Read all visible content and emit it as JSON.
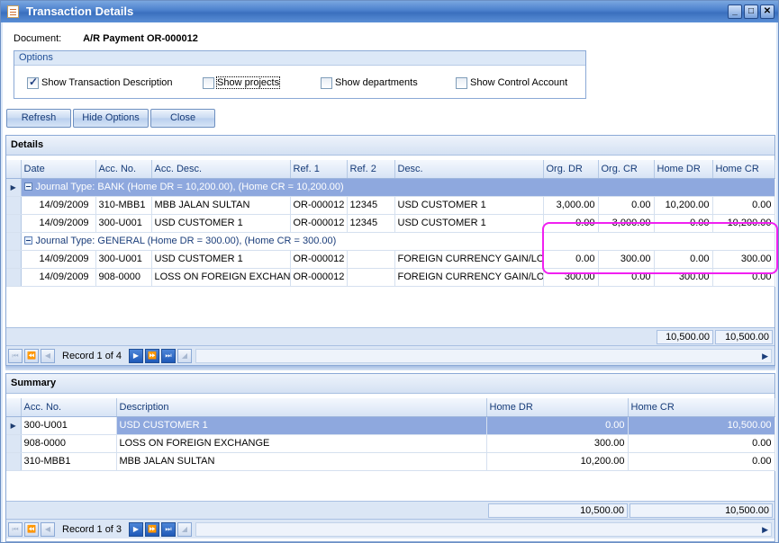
{
  "window": {
    "title": "Transaction Details",
    "controls": [
      "_",
      "□",
      "✕"
    ]
  },
  "document": {
    "label": "Document:",
    "value": "A/R Payment OR-000012"
  },
  "options": {
    "title": "Options",
    "items": [
      {
        "label": "Show Transaction Description",
        "checked": true
      },
      {
        "label": "Show projects",
        "checked": false
      },
      {
        "label": "Show departments",
        "checked": false
      },
      {
        "label": "Show Control Account",
        "checked": false
      }
    ]
  },
  "buttons": {
    "refresh": "Refresh",
    "hide_options": "Hide Options",
    "close": "Close"
  },
  "details": {
    "title": "Details",
    "columns": [
      "Date",
      "Acc. No.",
      "Acc. Desc.",
      "Ref. 1",
      "Ref. 2",
      "Desc.",
      "Org. DR",
      "Org. CR",
      "Home DR",
      "Home CR"
    ],
    "groups": [
      {
        "label": "Journal Type: BANK (Home DR = 10,200.00), (Home CR = 10,200.00)",
        "rows": [
          [
            "14/09/2009",
            "310-MBB1",
            "MBB JALAN SULTAN",
            "OR-000012",
            "12345",
            "USD CUSTOMER 1",
            "3,000.00",
            "0.00",
            "10,200.00",
            "0.00"
          ],
          [
            "14/09/2009",
            "300-U001",
            "USD CUSTOMER 1",
            "OR-000012",
            "12345",
            "USD CUSTOMER 1",
            "0.00",
            "3,000.00",
            "0.00",
            "10,200.00"
          ]
        ]
      },
      {
        "label": "Journal Type: GENERAL (Home DR = 300.00), (Home CR = 300.00)",
        "rows": [
          [
            "14/09/2009",
            "300-U001",
            "USD CUSTOMER 1",
            "OR-000012",
            "",
            "FOREIGN CURRENCY GAIN/LOSS",
            "0.00",
            "300.00",
            "0.00",
            "300.00"
          ],
          [
            "14/09/2009",
            "908-0000",
            "LOSS ON FOREIGN EXCHANGE",
            "OR-000012",
            "",
            "FOREIGN CURRENCY GAIN/LOSS",
            "300.00",
            "0.00",
            "300.00",
            "0.00"
          ]
        ]
      }
    ],
    "totals": {
      "home_dr": "10,500.00",
      "home_cr": "10,500.00"
    },
    "navigator": "Record 1 of 4"
  },
  "summary": {
    "title": "Summary",
    "columns": [
      "Acc. No.",
      "Description",
      "Home DR",
      "Home CR"
    ],
    "rows": [
      [
        "300-U001",
        "USD CUSTOMER 1",
        "0.00",
        "10,500.00"
      ],
      [
        "908-0000",
        "LOSS ON FOREIGN EXCHANGE",
        "300.00",
        "0.00"
      ],
      [
        "310-MBB1",
        "MBB JALAN SULTAN",
        "10,200.00",
        "0.00"
      ]
    ],
    "totals": {
      "home_dr": "10,500.00",
      "home_cr": "10,500.00"
    },
    "navigator": "Record 1 of 3"
  },
  "colors": {
    "title_bar": "#4a7fcc",
    "selection": "#8ea8de",
    "annotation": "#f020f0"
  }
}
